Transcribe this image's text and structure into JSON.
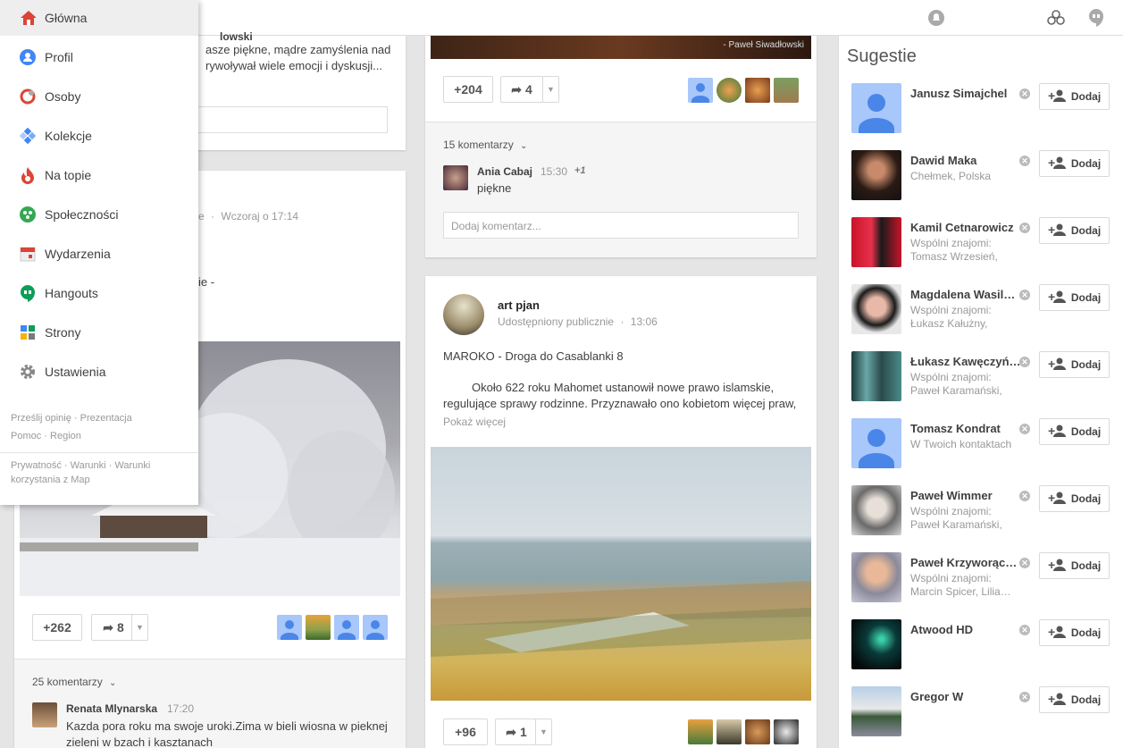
{
  "menu": {
    "items": [
      {
        "label": "Główna",
        "icon": "home-icon",
        "active": true
      },
      {
        "label": "Profil",
        "icon": "profile-icon"
      },
      {
        "label": "Osoby",
        "icon": "people-icon"
      },
      {
        "label": "Kolekcje",
        "icon": "collections-icon"
      },
      {
        "label": "Na topie",
        "icon": "trending-icon"
      },
      {
        "label": "Społeczności",
        "icon": "communities-icon"
      },
      {
        "label": "Wydarzenia",
        "icon": "events-icon"
      },
      {
        "label": "Hangouts",
        "icon": "hangouts-icon"
      },
      {
        "label": "Strony",
        "icon": "pages-icon"
      },
      {
        "label": "Ustawienia",
        "icon": "settings-icon"
      }
    ],
    "footer1": [
      "Prześlij opinię",
      "Prezentacja"
    ],
    "footer2": [
      "Pomoc",
      "Region"
    ],
    "footer3": [
      "Prywatność",
      "Warunki",
      "Warunki korzystania z Map"
    ]
  },
  "post1": {
    "author_frag": "lowski",
    "text_line1": "asze piękne, mądre zamyślenia nad",
    "text_line2": "rywoływał wiele emocji i dyskusji..."
  },
  "post2": {
    "meta_frag": "e",
    "time": "Wczoraj o 17:14",
    "text_frag": "ie -",
    "plus_count": "+262",
    "share_count": "8",
    "comments_label": "25 komentarzy",
    "comment": {
      "author": "Renata Mlynarska",
      "time": "17:20",
      "text_line1": "Kazda pora roku ma swoje uroki.Zima w bieli wiosna w pieknej",
      "text_line2": "zieleni w bzach i kasztanach"
    }
  },
  "post3": {
    "photo_credit": "- Paweł Siwadłowski",
    "plus_count": "+204",
    "share_count": "4",
    "comments_label": "15 komentarzy",
    "comment": {
      "author": "Ania Cabaj",
      "time": "15:30",
      "plus": "+1",
      "text": "piękne"
    },
    "comment_placeholder": "Dodaj komentarz..."
  },
  "post4": {
    "author": "art pjan",
    "visibility": "Udostępniony publicznie",
    "time": "13:06",
    "title": "MAROKO - Droga do Casablanki 8",
    "body_line1": "Około 622 roku Mahomet ustanowił nowe prawo islamskie,",
    "body_line2": "regulujące sprawy rodzinne. Przyznawało ono kobietom więcej praw,",
    "show_more": "Pokaż więcej",
    "plus_count": "+96",
    "share_count": "1"
  },
  "suggestions": {
    "title": "Sugestie",
    "add_label": "Dodaj",
    "people": [
      {
        "name": "Janusz Simajchel",
        "sub": ""
      },
      {
        "name": "Dawid Maka",
        "sub": "Chełmek, Polska"
      },
      {
        "name": "Kamil Cetnarowicz",
        "sub": "Wspólni znajomi: Tomasz Wrzesień, Mac"
      },
      {
        "name": "Magdalena Wasil…",
        "sub": "Wspólni znajomi: Łukasz Kałużny, Bart…"
      },
      {
        "name": "Łukasz Kawęczyń…",
        "sub": "Wspólni znajomi: Paweł Karamański, Ma"
      },
      {
        "name": "Tomasz Kondrat",
        "sub": "W Twoich kontaktach"
      },
      {
        "name": "Paweł Wimmer",
        "sub": "Wspólni znajomi: Paweł Karamański, Ad"
      },
      {
        "name": "Paweł Krzyworąc…",
        "sub": "Wspólni znajomi: Marcin Spicer, Lilia…"
      },
      {
        "name": "Atwood HD",
        "sub": ""
      },
      {
        "name": "Gregor W",
        "sub": ""
      }
    ]
  }
}
